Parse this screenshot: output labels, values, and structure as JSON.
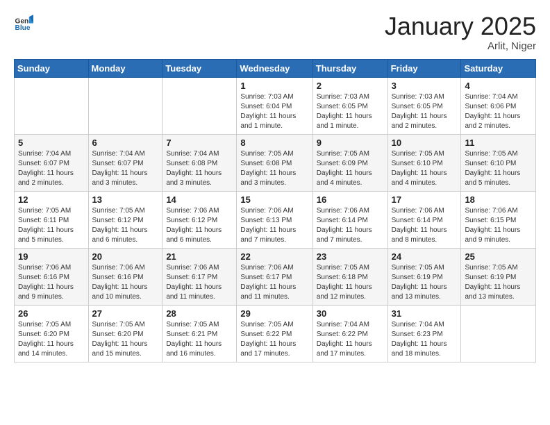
{
  "header": {
    "logo_general": "General",
    "logo_blue": "Blue",
    "month": "January 2025",
    "location": "Arlit, Niger"
  },
  "weekdays": [
    "Sunday",
    "Monday",
    "Tuesday",
    "Wednesday",
    "Thursday",
    "Friday",
    "Saturday"
  ],
  "weeks": [
    [
      {
        "day": "",
        "info": ""
      },
      {
        "day": "",
        "info": ""
      },
      {
        "day": "",
        "info": ""
      },
      {
        "day": "1",
        "info": "Sunrise: 7:03 AM\nSunset: 6:04 PM\nDaylight: 11 hours\nand 1 minute."
      },
      {
        "day": "2",
        "info": "Sunrise: 7:03 AM\nSunset: 6:05 PM\nDaylight: 11 hours\nand 1 minute."
      },
      {
        "day": "3",
        "info": "Sunrise: 7:03 AM\nSunset: 6:05 PM\nDaylight: 11 hours\nand 2 minutes."
      },
      {
        "day": "4",
        "info": "Sunrise: 7:04 AM\nSunset: 6:06 PM\nDaylight: 11 hours\nand 2 minutes."
      }
    ],
    [
      {
        "day": "5",
        "info": "Sunrise: 7:04 AM\nSunset: 6:07 PM\nDaylight: 11 hours\nand 2 minutes."
      },
      {
        "day": "6",
        "info": "Sunrise: 7:04 AM\nSunset: 6:07 PM\nDaylight: 11 hours\nand 3 minutes."
      },
      {
        "day": "7",
        "info": "Sunrise: 7:04 AM\nSunset: 6:08 PM\nDaylight: 11 hours\nand 3 minutes."
      },
      {
        "day": "8",
        "info": "Sunrise: 7:05 AM\nSunset: 6:08 PM\nDaylight: 11 hours\nand 3 minutes."
      },
      {
        "day": "9",
        "info": "Sunrise: 7:05 AM\nSunset: 6:09 PM\nDaylight: 11 hours\nand 4 minutes."
      },
      {
        "day": "10",
        "info": "Sunrise: 7:05 AM\nSunset: 6:10 PM\nDaylight: 11 hours\nand 4 minutes."
      },
      {
        "day": "11",
        "info": "Sunrise: 7:05 AM\nSunset: 6:10 PM\nDaylight: 11 hours\nand 5 minutes."
      }
    ],
    [
      {
        "day": "12",
        "info": "Sunrise: 7:05 AM\nSunset: 6:11 PM\nDaylight: 11 hours\nand 5 minutes."
      },
      {
        "day": "13",
        "info": "Sunrise: 7:05 AM\nSunset: 6:12 PM\nDaylight: 11 hours\nand 6 minutes."
      },
      {
        "day": "14",
        "info": "Sunrise: 7:06 AM\nSunset: 6:12 PM\nDaylight: 11 hours\nand 6 minutes."
      },
      {
        "day": "15",
        "info": "Sunrise: 7:06 AM\nSunset: 6:13 PM\nDaylight: 11 hours\nand 7 minutes."
      },
      {
        "day": "16",
        "info": "Sunrise: 7:06 AM\nSunset: 6:14 PM\nDaylight: 11 hours\nand 7 minutes."
      },
      {
        "day": "17",
        "info": "Sunrise: 7:06 AM\nSunset: 6:14 PM\nDaylight: 11 hours\nand 8 minutes."
      },
      {
        "day": "18",
        "info": "Sunrise: 7:06 AM\nSunset: 6:15 PM\nDaylight: 11 hours\nand 9 minutes."
      }
    ],
    [
      {
        "day": "19",
        "info": "Sunrise: 7:06 AM\nSunset: 6:16 PM\nDaylight: 11 hours\nand 9 minutes."
      },
      {
        "day": "20",
        "info": "Sunrise: 7:06 AM\nSunset: 6:16 PM\nDaylight: 11 hours\nand 10 minutes."
      },
      {
        "day": "21",
        "info": "Sunrise: 7:06 AM\nSunset: 6:17 PM\nDaylight: 11 hours\nand 11 minutes."
      },
      {
        "day": "22",
        "info": "Sunrise: 7:06 AM\nSunset: 6:17 PM\nDaylight: 11 hours\nand 11 minutes."
      },
      {
        "day": "23",
        "info": "Sunrise: 7:05 AM\nSunset: 6:18 PM\nDaylight: 11 hours\nand 12 minutes."
      },
      {
        "day": "24",
        "info": "Sunrise: 7:05 AM\nSunset: 6:19 PM\nDaylight: 11 hours\nand 13 minutes."
      },
      {
        "day": "25",
        "info": "Sunrise: 7:05 AM\nSunset: 6:19 PM\nDaylight: 11 hours\nand 13 minutes."
      }
    ],
    [
      {
        "day": "26",
        "info": "Sunrise: 7:05 AM\nSunset: 6:20 PM\nDaylight: 11 hours\nand 14 minutes."
      },
      {
        "day": "27",
        "info": "Sunrise: 7:05 AM\nSunset: 6:20 PM\nDaylight: 11 hours\nand 15 minutes."
      },
      {
        "day": "28",
        "info": "Sunrise: 7:05 AM\nSunset: 6:21 PM\nDaylight: 11 hours\nand 16 minutes."
      },
      {
        "day": "29",
        "info": "Sunrise: 7:05 AM\nSunset: 6:22 PM\nDaylight: 11 hours\nand 17 minutes."
      },
      {
        "day": "30",
        "info": "Sunrise: 7:04 AM\nSunset: 6:22 PM\nDaylight: 11 hours\nand 17 minutes."
      },
      {
        "day": "31",
        "info": "Sunrise: 7:04 AM\nSunset: 6:23 PM\nDaylight: 11 hours\nand 18 minutes."
      },
      {
        "day": "",
        "info": ""
      }
    ]
  ]
}
